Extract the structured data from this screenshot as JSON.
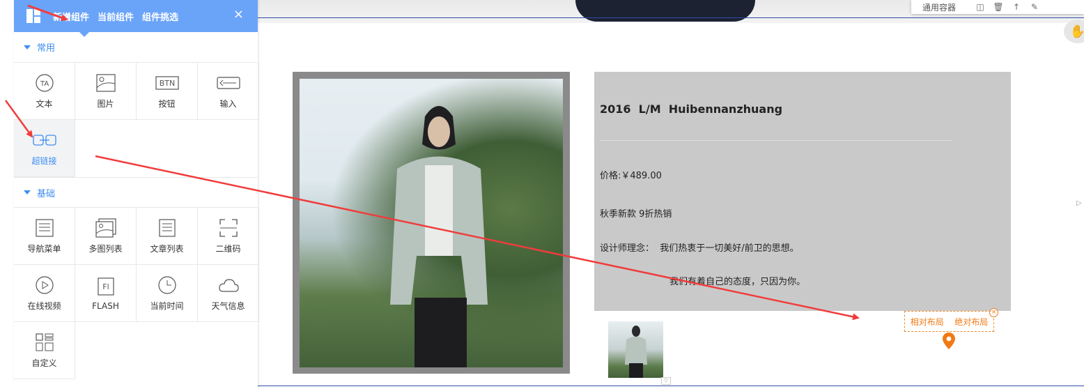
{
  "panel": {
    "tabs": [
      "新增组件",
      "当前组件",
      "组件挑选"
    ],
    "close_icon": "×",
    "sections": [
      {
        "title": "常用",
        "items": [
          {
            "label": "文本",
            "icon": "text-icon"
          },
          {
            "label": "图片",
            "icon": "image-icon"
          },
          {
            "label": "按钮",
            "icon": "button-icon",
            "icon_text": "BTN"
          },
          {
            "label": "输入",
            "icon": "input-icon"
          },
          {
            "label": "超链接",
            "icon": "link-icon",
            "active": true
          }
        ]
      },
      {
        "title": "基础",
        "items": [
          {
            "label": "导航菜单",
            "icon": "nav-menu-icon"
          },
          {
            "label": "多图列表",
            "icon": "multi-image-icon"
          },
          {
            "label": "文章列表",
            "icon": "article-list-icon"
          },
          {
            "label": "二维码",
            "icon": "qrcode-icon"
          },
          {
            "label": "在线视频",
            "icon": "video-icon"
          },
          {
            "label": "FLASH",
            "icon": "flash-icon",
            "icon_text": "Fl"
          },
          {
            "label": "当前时间",
            "icon": "clock-icon"
          },
          {
            "label": "天气信息",
            "icon": "weather-icon"
          },
          {
            "label": "自定义",
            "icon": "custom-icon"
          }
        ]
      }
    ],
    "accent_color": "#6aa4f9"
  },
  "toolbar": {
    "label": "通用容器"
  },
  "product": {
    "title": "2016  L/M  Huibennanzhuang",
    "price": "价格:￥489.00",
    "promo": "秋季新款 9折热销",
    "concept": "设计师理念：  我们热衷于一切美好/前卫的思想。",
    "attitude": "我们有着自己的态度，只因为你。"
  },
  "layout_widget": {
    "relative": "相对布局",
    "absolute": "绝对布局",
    "color": "#f07a14"
  },
  "annotation_color": "#f03c3c"
}
